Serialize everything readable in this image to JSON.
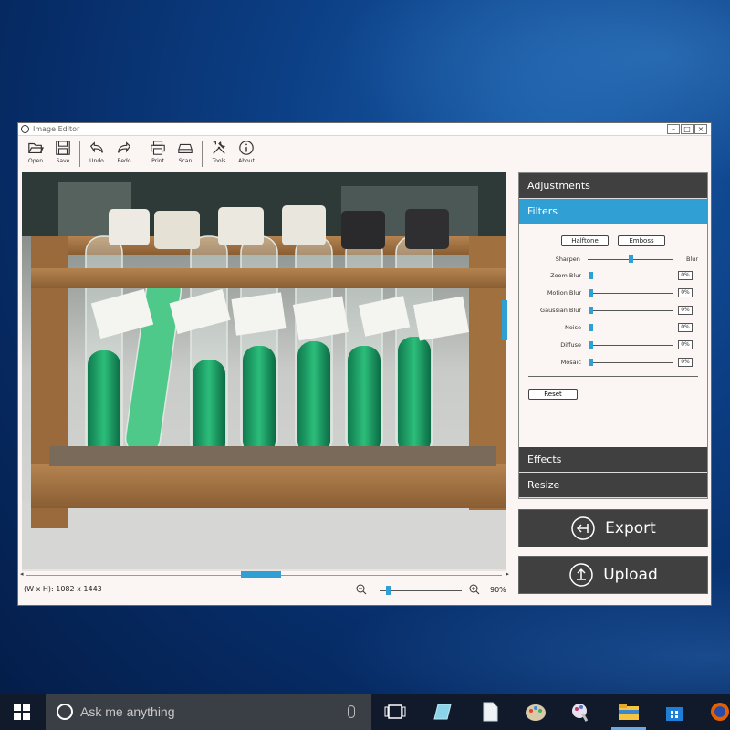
{
  "window": {
    "title": "Image Editor"
  },
  "toolbar": {
    "open": "Open",
    "save": "Save",
    "undo": "Undo",
    "redo": "Redo",
    "print": "Print",
    "scan": "Scan",
    "tools": "Tools",
    "about": "About"
  },
  "status": {
    "dimensions": "(W x H): 1082 x 1443",
    "zoom": "90%",
    "zoom_fraction": 0.1
  },
  "panel": {
    "adjustments": "Adjustments",
    "filters": "Filters",
    "effects": "Effects",
    "resize": "Resize",
    "halftone": "Halftone",
    "emboss": "Emboss",
    "sharpen": "Sharpen",
    "blur": "Blur",
    "sliders": [
      {
        "label": "Zoom Blur",
        "value": "0%"
      },
      {
        "label": "Motion Blur",
        "value": "0%"
      },
      {
        "label": "Gaussian Blur",
        "value": "0%"
      },
      {
        "label": "Noise",
        "value": "0%"
      },
      {
        "label": "Diffuse",
        "value": "0%"
      },
      {
        "label": "Mosaic",
        "value": "0%"
      }
    ],
    "reset": "Reset"
  },
  "actions": {
    "export": "Export",
    "upload": "Upload"
  },
  "taskbar": {
    "search_placeholder": "Ask me anything"
  },
  "colors": {
    "accent": "#2f9fd4",
    "panel_dark": "#404040"
  }
}
